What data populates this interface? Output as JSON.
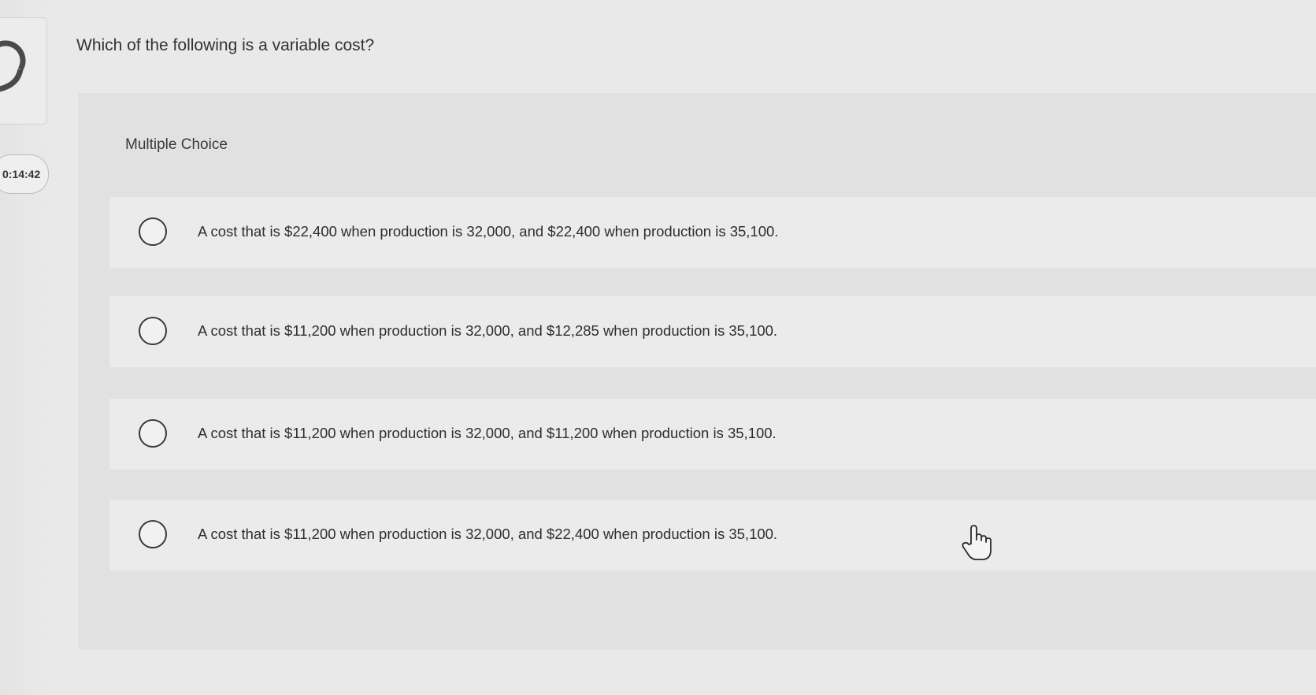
{
  "sidebar": {
    "progress_icon": "progress-ring-icon",
    "timer": "0:14:42"
  },
  "question": {
    "prompt": "Which of the following is a variable cost?",
    "type_label": "Multiple Choice"
  },
  "choices": [
    {
      "text": "A cost that is $22,400 when production is 32,000, and $22,400 when production is 35,100."
    },
    {
      "text": "A cost that is $11,200 when production is 32,000, and $12,285 when production is 35,100."
    },
    {
      "text": "A cost that is $11,200 when production is 32,000, and $11,200 when production is 35,100."
    },
    {
      "text": "A cost that is $11,200 when production is 32,000, and $22,400 when production is 35,100."
    }
  ],
  "cursor": {
    "icon": "hand-pointer-icon"
  }
}
